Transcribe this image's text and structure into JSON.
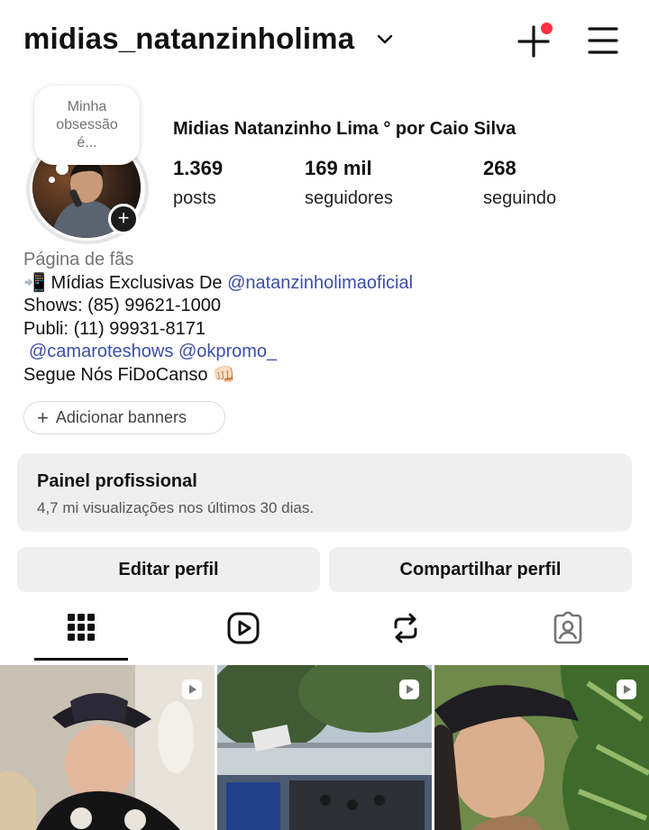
{
  "header": {
    "username": "midias_natanzinholima",
    "icons": [
      "chevron-down-icon",
      "create-plus-icon",
      "menu-icon"
    ],
    "notification_dot_color": "#ff3040"
  },
  "profile": {
    "note_text": "Minha obsessão é...",
    "display_name": "Midias Natanzinho Lima ° por Caio Silva",
    "stats": [
      {
        "value": "1.369",
        "label": "posts"
      },
      {
        "value": "169 mil",
        "label": "seguidores"
      },
      {
        "value": "268",
        "label": "seguindo"
      }
    ]
  },
  "bio": {
    "category": "Página de fãs",
    "line1_prefix": "📲 Mídias Exclusivas De ",
    "line1_mention": "@natanzinholimaoficial",
    "line2": "Shows: (85) 99621-1000",
    "line3": "Publi: (11) 99931-8171",
    "mention2": "@camaroteshows",
    "mention3": "@okpromo_",
    "line5": "Segue Nós FiDoCanso 👊🏻",
    "mention_color": "#3b4ea8"
  },
  "banner_button": {
    "label": "Adicionar banners"
  },
  "pro_panel": {
    "title": "Painel profissional",
    "subtitle": "4,7 mi visualizações nos últimos 30 dias."
  },
  "actions": {
    "edit": "Editar perfil",
    "share": "Compartilhar perfil"
  },
  "tabs": [
    {
      "icon": "grid-icon",
      "active": true
    },
    {
      "icon": "reels-icon",
      "active": false
    },
    {
      "icon": "reposts-icon",
      "active": false
    },
    {
      "icon": "tagged-icon",
      "active": false
    }
  ],
  "grid": {
    "tiles": [
      {
        "type": "reel",
        "icon": "reel-badge-icon"
      },
      {
        "type": "reel",
        "icon": "reel-badge-icon"
      },
      {
        "type": "reel",
        "icon": "reel-badge-icon"
      }
    ]
  }
}
